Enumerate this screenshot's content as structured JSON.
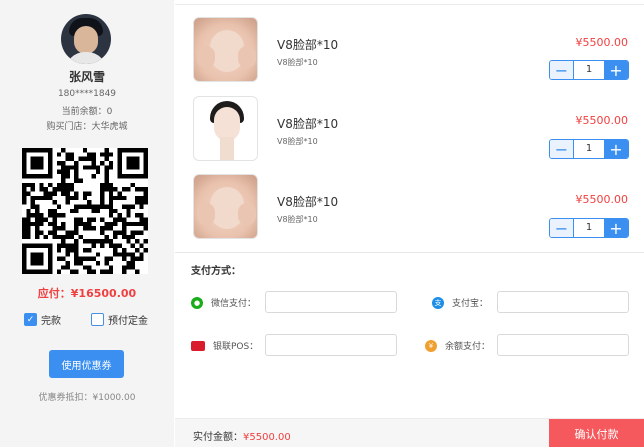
{
  "customer": {
    "name": "张风雪",
    "phone": "180****1849",
    "balance": "当前余额：0",
    "store": "购买门店：大华虎城"
  },
  "payment_due": "应付：¥16500.00",
  "options": {
    "full_payment": "完款",
    "deposit": "预付定金"
  },
  "coupon": {
    "button": "使用优惠券",
    "deduction": "优惠券抵扣：¥1000.00"
  },
  "products": [
    {
      "title": "V8脸部*10",
      "subtitle": "V8脸部*10",
      "price": "¥5500.00",
      "qty": "1"
    },
    {
      "title": "V8脸部*10",
      "subtitle": "V8脸部*10",
      "price": "¥5500.00",
      "qty": "1"
    },
    {
      "title": "V8脸部*10",
      "subtitle": "V8脸部*10",
      "price": "¥5500.00",
      "qty": "1"
    }
  ],
  "payment": {
    "title": "支付方式：",
    "wechat": "微信支付：",
    "alipay": "支付宝：",
    "unionpay": "银联POS：",
    "balance": "余额支付："
  },
  "footer": {
    "actual_label": "实付金额：",
    "actual_amount": "¥5500.00",
    "confirm": "确认付款"
  },
  "colors": {
    "accent": "#3b8ff0",
    "price": "#f04141",
    "confirm": "#f5595d",
    "wechat": "#1aad19",
    "alipay": "#1c8ee8",
    "unionpay": "#d91c2b",
    "balance": "#f0a030"
  },
  "icons": {
    "wechat": "wechat-icon",
    "alipay": "alipay-icon",
    "unionpay": "unionpay-icon",
    "balance": "wallet-icon",
    "qr": "qr-code"
  }
}
